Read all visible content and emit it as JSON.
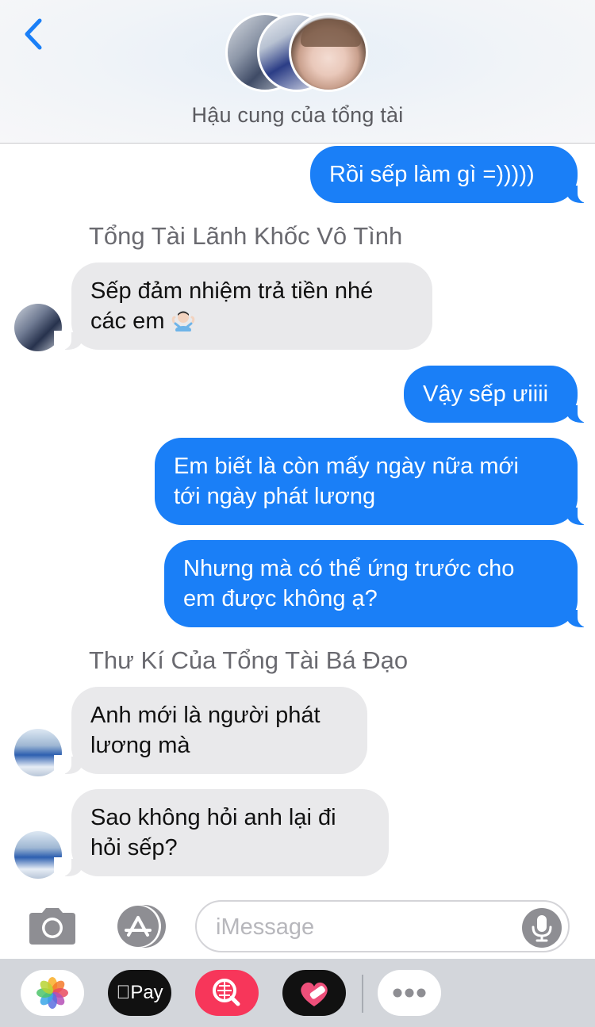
{
  "header": {
    "back_icon": "chevron-left-icon",
    "group_name": "Hậu cung của tổng tài"
  },
  "messages": [
    {
      "direction": "outgoing",
      "text": "Rồi sếp làm gì =)))))"
    },
    {
      "direction": "incoming",
      "sender": "Tổng Tài Lãnh Khốc Vô Tình",
      "line1": "Sếp đảm nhiệm trả tiền nhé",
      "line2": "các em",
      "emoji": "person-shrugging-emoji"
    },
    {
      "direction": "outgoing",
      "text": "Vậy sếp ưiiii"
    },
    {
      "direction": "outgoing",
      "line1": "Em biết là còn mấy ngày nữa mới",
      "line2": "tới ngày phát lương"
    },
    {
      "direction": "outgoing",
      "line1": "Nhưng mà có thể ứng trước cho",
      "line2": "em được không ạ?"
    },
    {
      "direction": "incoming",
      "sender": "Thư Kí Của Tổng Tài Bá Đạo",
      "line1": "Anh mới là người phát",
      "line2": "lương mà"
    },
    {
      "direction": "incoming",
      "line1": "Sao không hỏi anh lại đi",
      "line2": "hỏi sếp?"
    }
  ],
  "input_bar": {
    "placeholder": "iMessage",
    "camera_icon": "camera-icon",
    "appstore_icon": "app-store-icon",
    "mic_icon": "microphone-icon"
  },
  "app_drawer": {
    "apps": [
      "photos-icon",
      "apple-pay-icon",
      "image-search-icon",
      "heart-sticker-icon",
      "more-icon"
    ],
    "pay_label": "Pay"
  },
  "colors": {
    "outgoing_bubble": "#1a7ff7",
    "incoming_bubble": "#e9e9eb",
    "accent": "#1a7ff7"
  }
}
